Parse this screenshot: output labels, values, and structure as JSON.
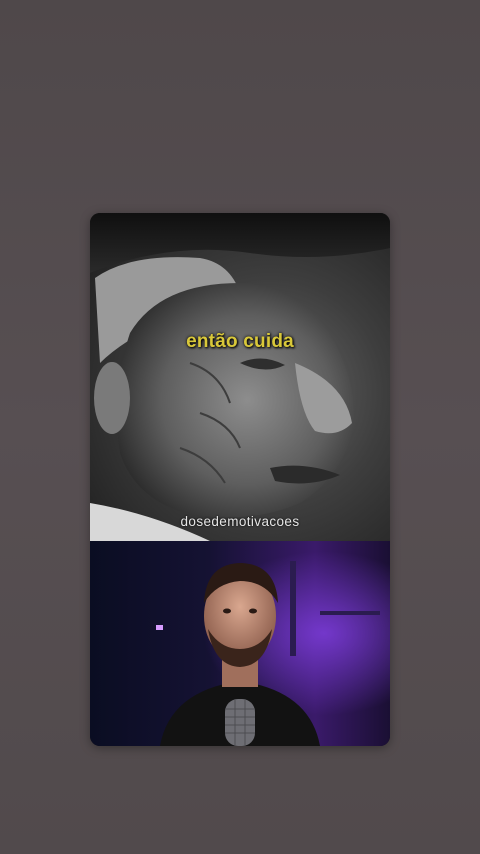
{
  "video": {
    "caption": "então cuida",
    "watermark": "dosedemotivacoes"
  }
}
